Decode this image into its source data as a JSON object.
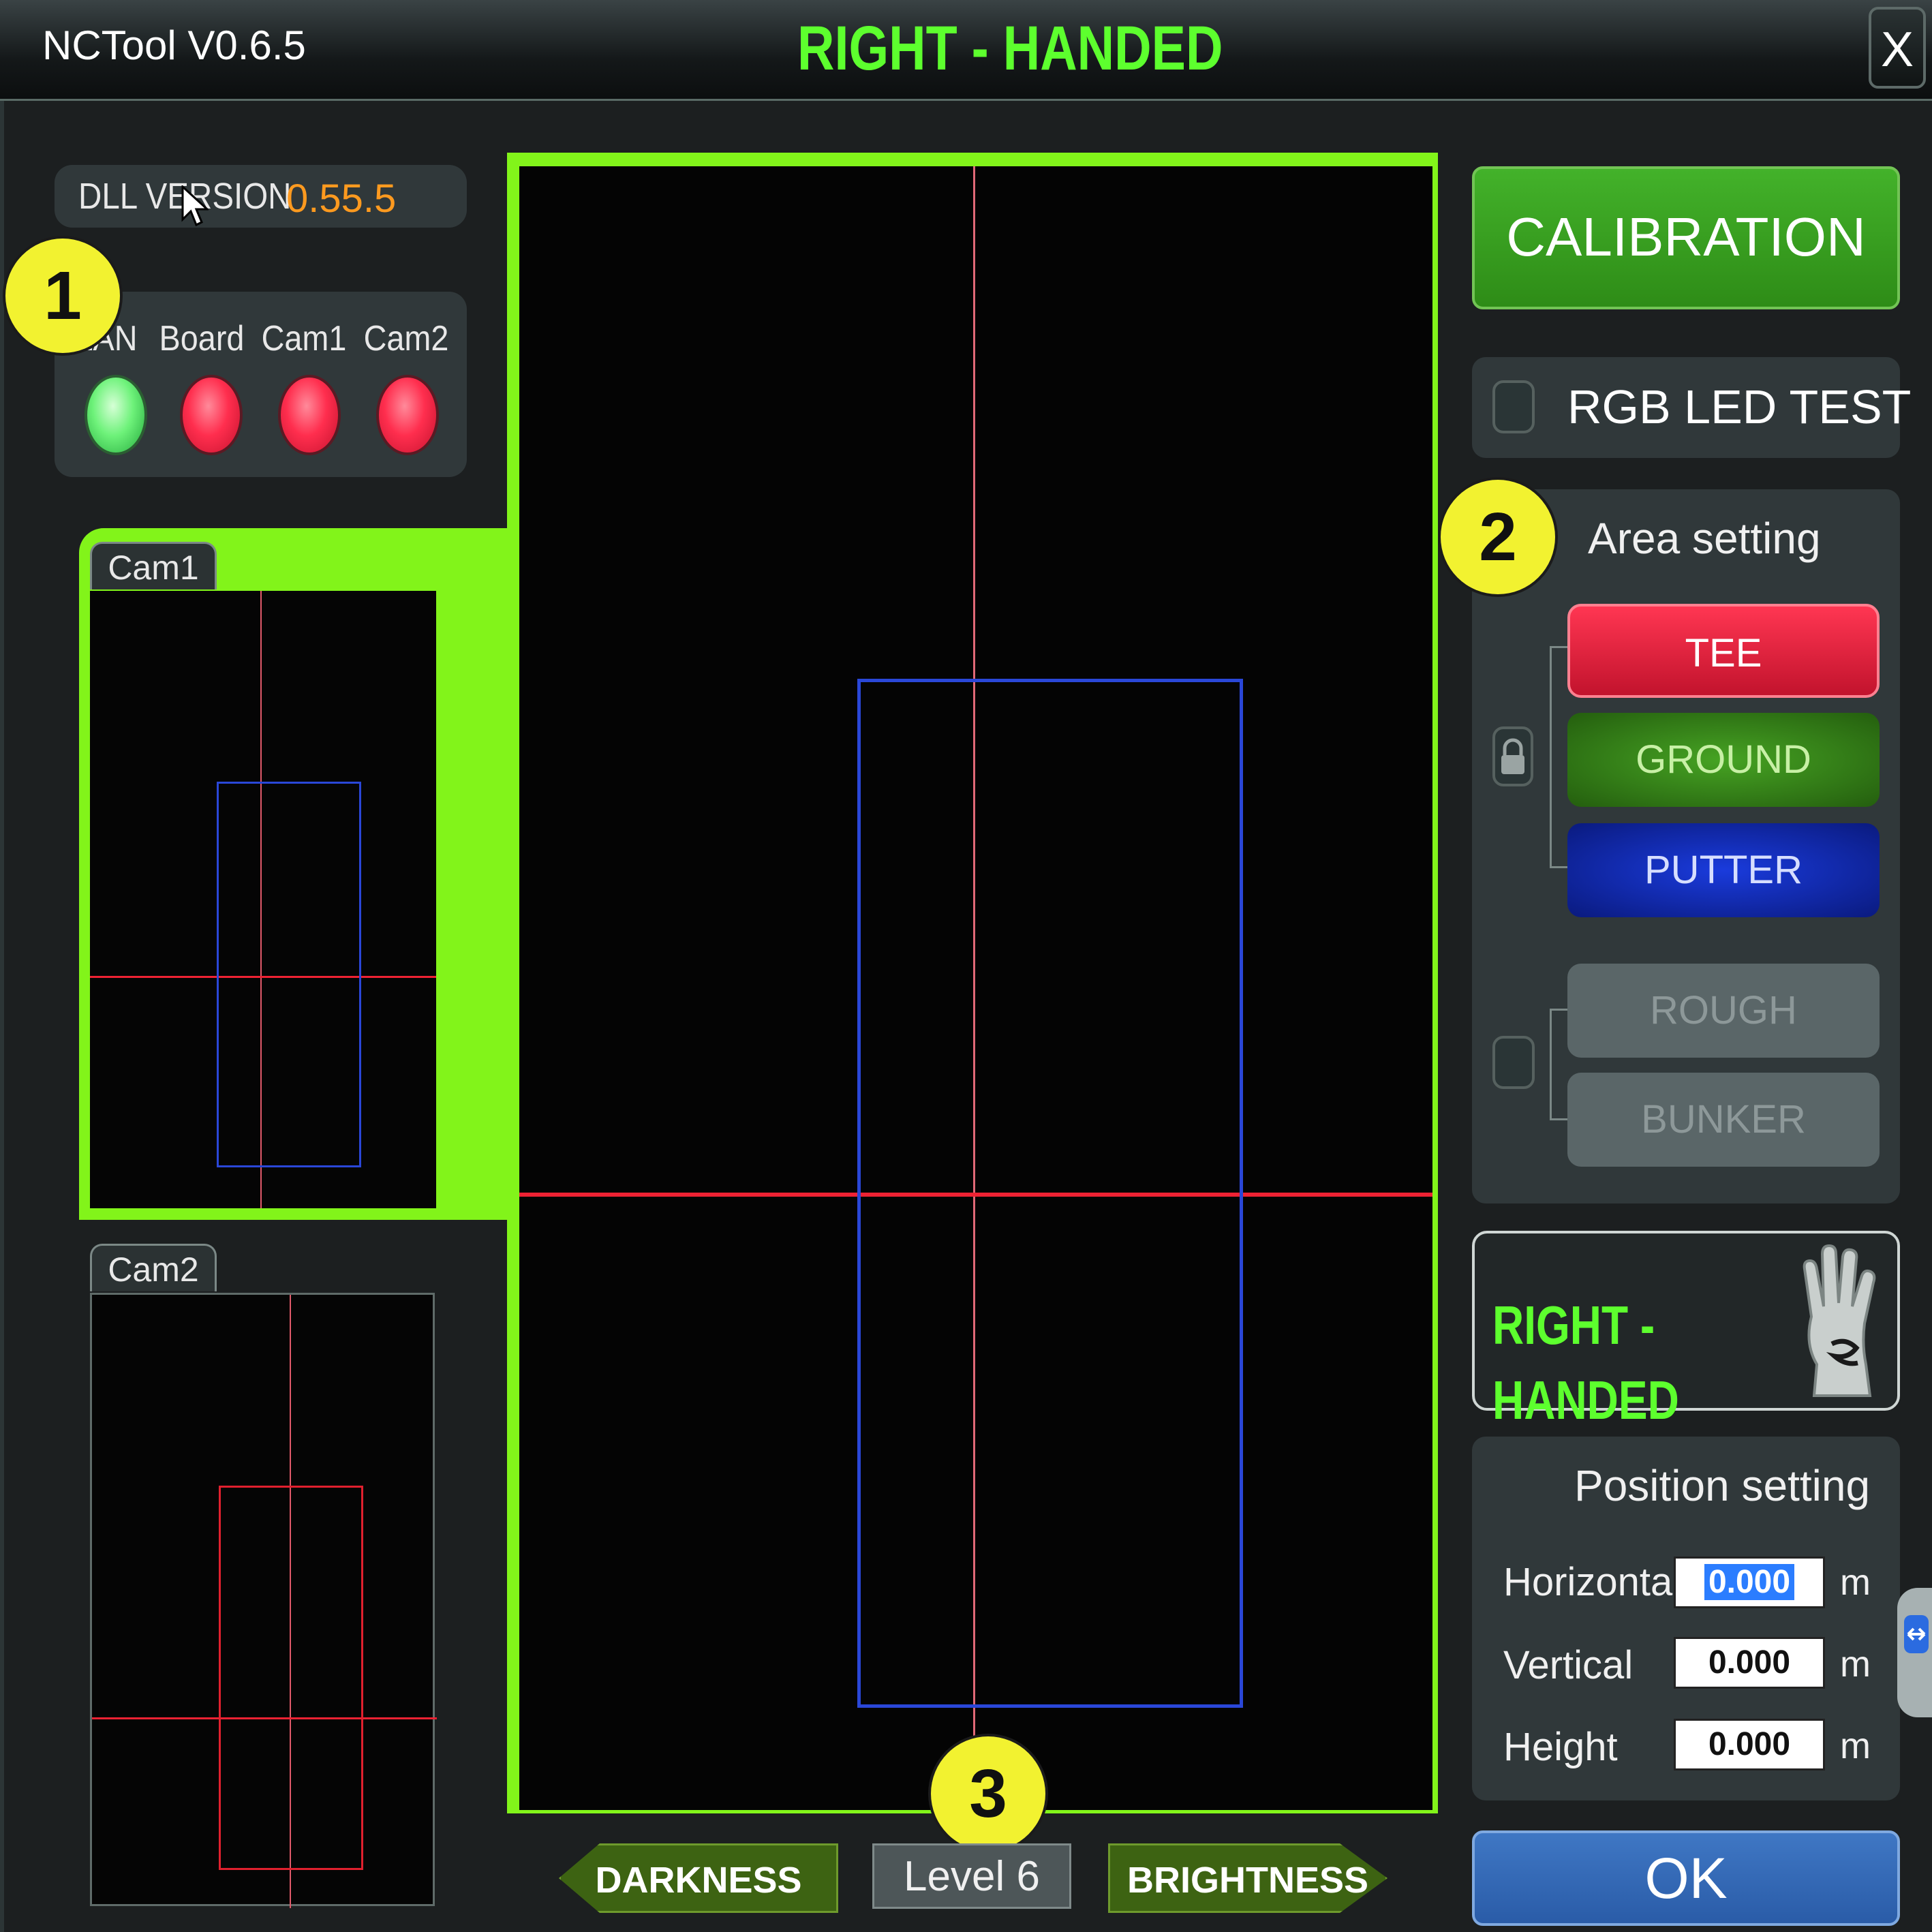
{
  "window": {
    "app_title": "NCTool V0.6.5",
    "mode_title": "RIGHT - HANDED",
    "close_label": "X"
  },
  "dll": {
    "label": "DLL VERSION",
    "value": "0.55.5"
  },
  "status": {
    "items": [
      {
        "label": "LAN",
        "state": "green"
      },
      {
        "label": "Board",
        "state": "red"
      },
      {
        "label": "Cam1",
        "state": "red"
      },
      {
        "label": "Cam2",
        "state": "red"
      }
    ]
  },
  "markers": [
    "1",
    "2",
    "3"
  ],
  "cameras": {
    "cam1_label": "Cam1",
    "cam2_label": "Cam2"
  },
  "brightness": {
    "darkness_label": "DARKNESS",
    "level_label": "Level 6",
    "brightness_label": "BRIGHTNESS"
  },
  "right_panel": {
    "calibration_label": "CALIBRATION",
    "rgb_led_label": "RGB LED TEST",
    "area": {
      "title": "Area setting",
      "buttons": [
        "TEE",
        "GROUND",
        "PUTTER",
        "ROUGH",
        "BUNKER"
      ]
    },
    "hand_label": "RIGHT - HANDED",
    "position": {
      "title": "Position setting",
      "horizontal_label": "Horizontal",
      "vertical_label": "Vertical",
      "height_label": "Height",
      "horizontal_value": "0.000",
      "vertical_value": "0.000",
      "height_value": "0.000",
      "unit": "m"
    },
    "ok_label": "OK"
  },
  "colors": {
    "accent_green": "#82f41a",
    "title_green": "#5dff2e",
    "version_orange": "#ff9a1f",
    "tee_red": "#e0203c",
    "putter_blue": "#1030c0"
  }
}
